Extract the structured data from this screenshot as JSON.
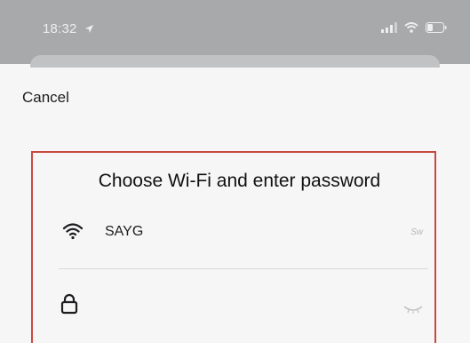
{
  "status_bar": {
    "time": "18:32"
  },
  "sheet": {
    "cancel_label": "Cancel",
    "title": "Choose Wi-Fi and enter password",
    "wifi": {
      "ssid": "SAYG",
      "switch_hint": "Sw"
    },
    "password": {
      "value": ""
    }
  },
  "colors": {
    "highlight_border": "#c9493f",
    "status_bar_bg": "#a8a9ab",
    "sheet_bg": "#f6f6f7"
  },
  "icons": [
    "location-arrow-icon",
    "cellular-signal-icon",
    "wifi-status-icon",
    "battery-icon",
    "wifi-icon",
    "lock-icon",
    "eye-closed-icon"
  ]
}
